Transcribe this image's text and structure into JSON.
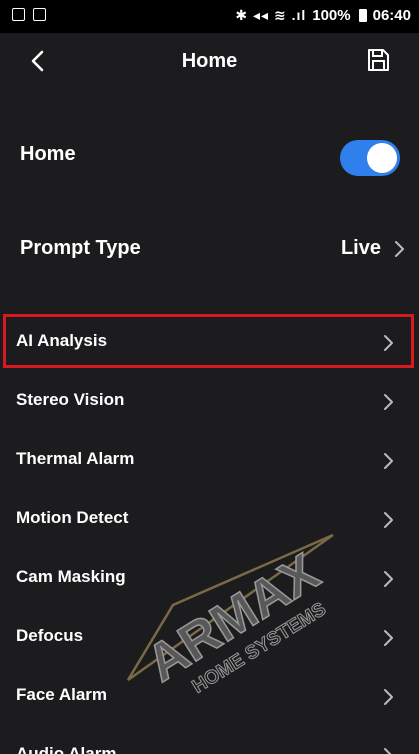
{
  "status_bar": {
    "left_icons": [
      "image-icon",
      "photo-icon"
    ],
    "signal_glyphs": "✱ ◂◂ ≋ .ıl",
    "battery_percent": "100%",
    "time": "06:40"
  },
  "header": {
    "title": "Home",
    "back_icon": "chevron-left-icon",
    "save_icon": "save-icon"
  },
  "home_toggle": {
    "label": "Home",
    "on": true,
    "color": "#2f80ed"
  },
  "prompt_type": {
    "label": "Prompt Type",
    "value": "Live"
  },
  "menu": {
    "items": [
      {
        "label": "AI Analysis",
        "highlighted": true
      },
      {
        "label": "Stereo Vision"
      },
      {
        "label": "Thermal Alarm"
      },
      {
        "label": "Motion Detect"
      },
      {
        "label": "Cam Masking"
      },
      {
        "label": "Defocus"
      },
      {
        "label": "Face Alarm"
      },
      {
        "label": "Audio Alarm"
      }
    ]
  },
  "watermark": {
    "brand": "ARMAX",
    "tagline": "HOME SYSTEMS"
  },
  "colors": {
    "background": "#1c1c1e",
    "highlight": "#d71920",
    "accent": "#2f80ed"
  }
}
